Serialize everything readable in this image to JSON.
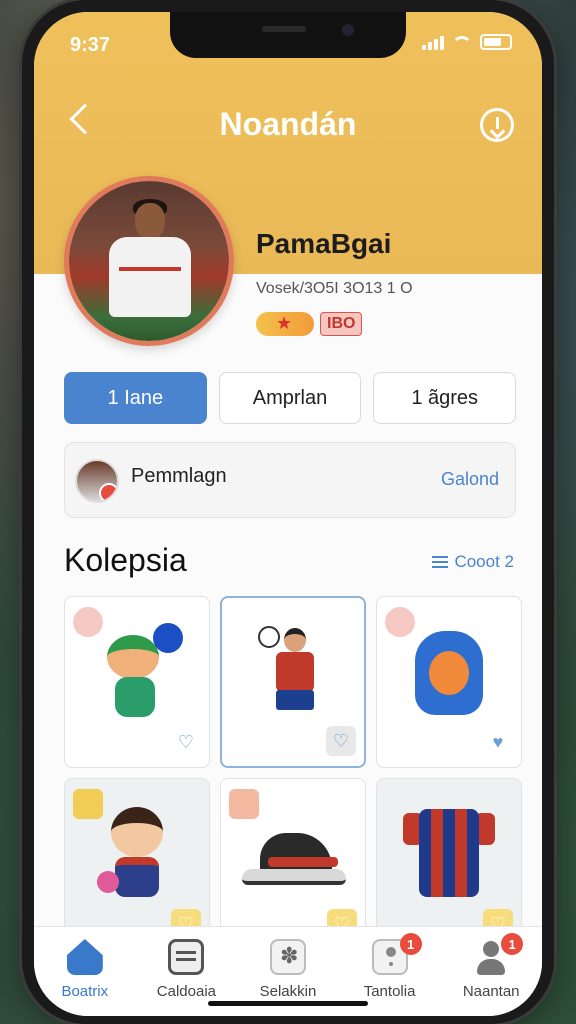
{
  "status_bar": {
    "time": "9:37"
  },
  "header": {
    "title": "Noandán",
    "back_icon": "chevron-left-icon",
    "action_icon": "download-circle-icon",
    "color": "#efc05a"
  },
  "profile": {
    "name": "PamaBgai",
    "subtitle": "Vosek/3O5I 3O13 1 O",
    "badge_value": "IBO"
  },
  "tabs": [
    {
      "label": "1 Iane",
      "active": true
    },
    {
      "label": "Amprlan",
      "active": false
    },
    {
      "label": "1 ãgres",
      "active": false
    }
  ],
  "friend": {
    "name": "Pemmlagn",
    "action": "Galond"
  },
  "collection": {
    "title": "Kolepsia",
    "link": "Cooot 2",
    "items": [
      {
        "name": "green mascot",
        "liked": false
      },
      {
        "name": "kid footballer",
        "liked": false
      },
      {
        "name": "blue hood mascot",
        "liked": true
      },
      {
        "name": "girl mascot",
        "liked": false
      },
      {
        "name": "football boot",
        "liked": false
      },
      {
        "name": "jersey",
        "liked": false
      }
    ]
  },
  "bottom_nav": [
    {
      "label": "Boatrix",
      "icon": "home-icon",
      "active": true,
      "badge": ""
    },
    {
      "label": "Caldoaia",
      "icon": "document-icon",
      "active": false,
      "badge": ""
    },
    {
      "label": "Selakkin",
      "icon": "fan-icon",
      "active": false,
      "badge": ""
    },
    {
      "label": "Tantolia",
      "icon": "pin-icon",
      "active": false,
      "badge": "1"
    },
    {
      "label": "Naantan",
      "icon": "person-icon",
      "active": false,
      "badge": "1"
    }
  ],
  "colors": {
    "accent": "#4a84cf",
    "header": "#efc05a",
    "badge": "#e74c3c"
  }
}
